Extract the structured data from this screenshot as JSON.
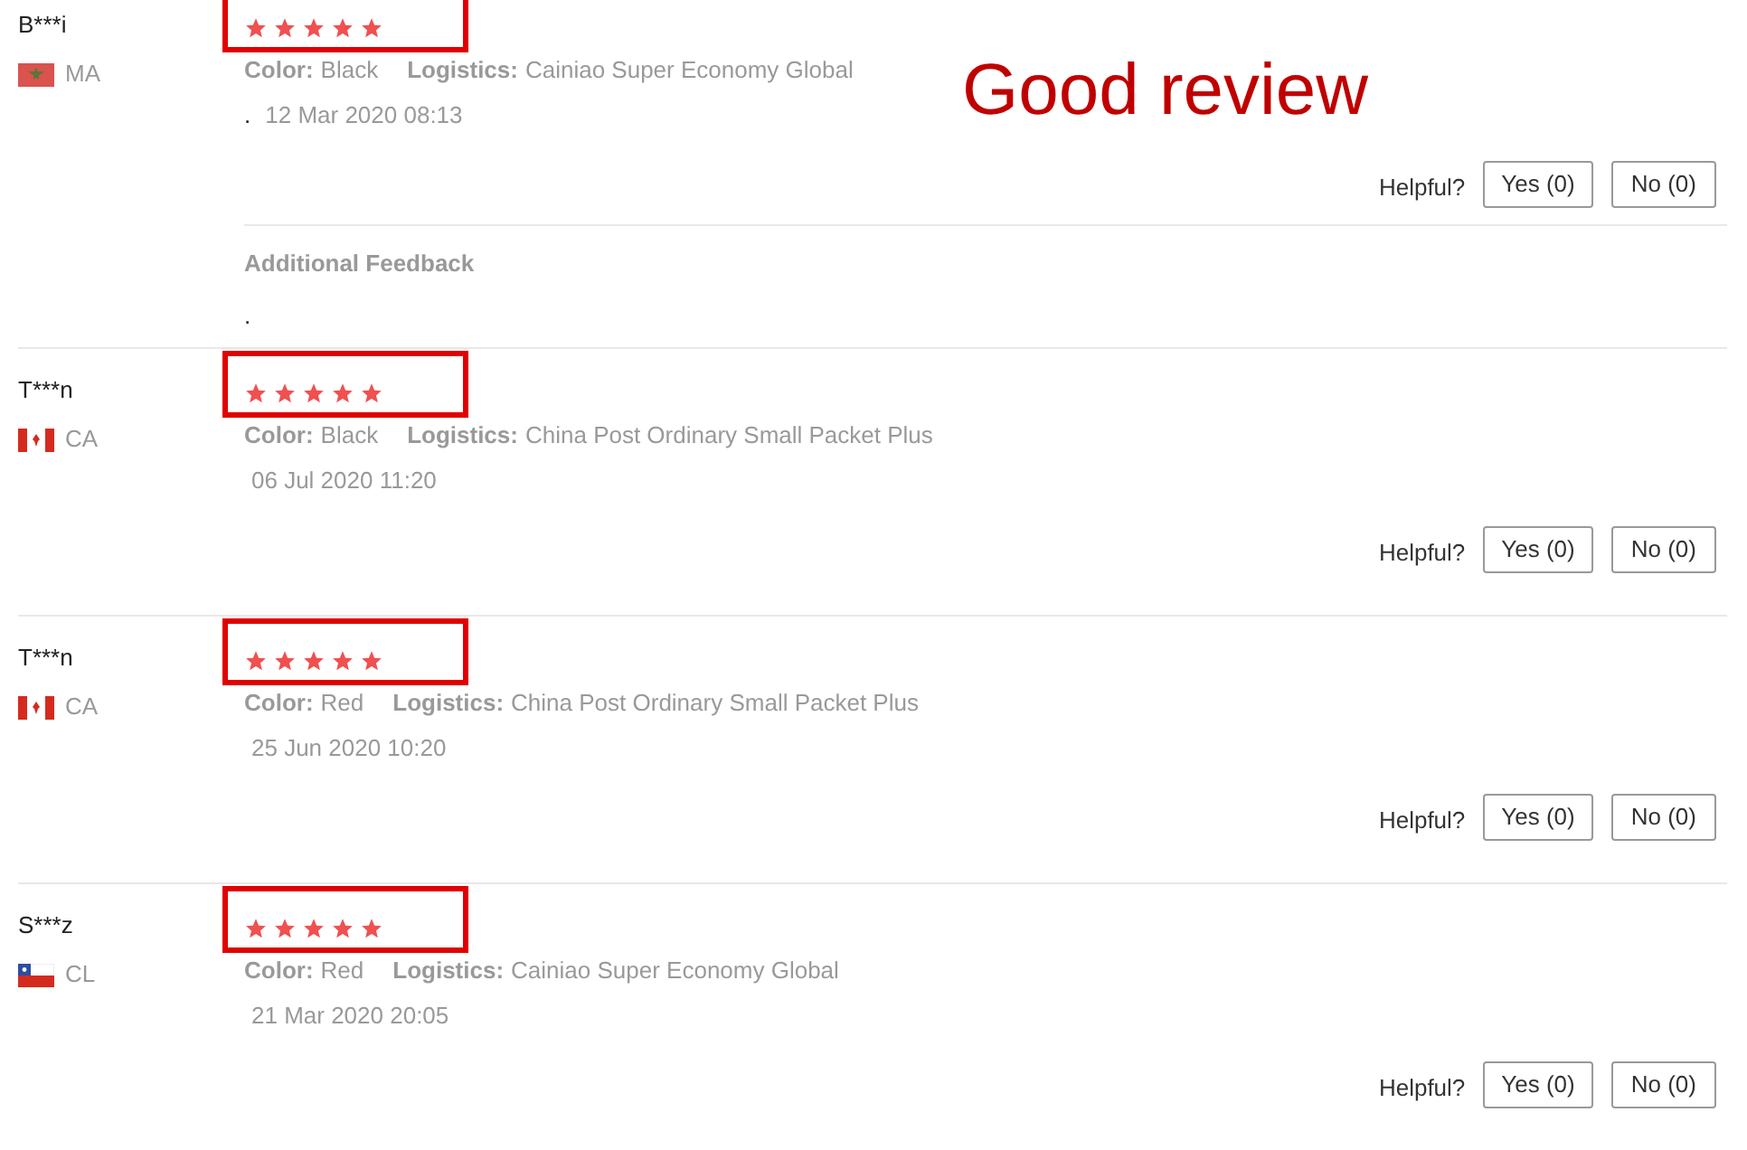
{
  "annotation": {
    "label": "Good review"
  },
  "reviews": [
    {
      "name": "B***i",
      "country": "MA",
      "country_flag": {
        "kind": "morocco"
      },
      "stars": 5,
      "highlighted": true,
      "color_label": "Color:",
      "color_value": "Black",
      "logistics_label": "Logistics:",
      "logistics_value": "Cainiao Super Economy Global",
      "text": ".",
      "date": "12 Mar 2020 08:13",
      "helpful_label": "Helpful?",
      "yes_button": "Yes (0)",
      "no_button": "No (0)",
      "additional_feedback": {
        "label": "Additional Feedback",
        "text": "."
      }
    },
    {
      "name": "T***n",
      "country": "CA",
      "country_flag": {
        "kind": "canada"
      },
      "stars": 5,
      "highlighted": true,
      "color_label": "Color:",
      "color_value": "Black",
      "logistics_label": "Logistics:",
      "logistics_value": "China Post Ordinary Small Packet Plus",
      "date": "06 Jul 2020 11:20",
      "helpful_label": "Helpful?",
      "yes_button": "Yes (0)",
      "no_button": "No (0)"
    },
    {
      "name": "T***n",
      "country": "CA",
      "country_flag": {
        "kind": "canada"
      },
      "stars": 5,
      "highlighted": true,
      "color_label": "Color:",
      "color_value": "Red",
      "logistics_label": "Logistics:",
      "logistics_value": "China Post Ordinary Small Packet Plus",
      "date": "25 Jun 2020 10:20",
      "helpful_label": "Helpful?",
      "yes_button": "Yes (0)",
      "no_button": "No (0)"
    },
    {
      "name": "S***z",
      "country": "CL",
      "country_flag": {
        "kind": "chile"
      },
      "stars": 5,
      "highlighted": true,
      "color_label": "Color:",
      "color_value": "Red",
      "logistics_label": "Logistics:",
      "logistics_value": "Cainiao Super Economy Global",
      "date": "21 Mar 2020 20:05",
      "helpful_label": "Helpful?",
      "yes_button": "Yes (0)",
      "no_button": "No (0)"
    }
  ]
}
